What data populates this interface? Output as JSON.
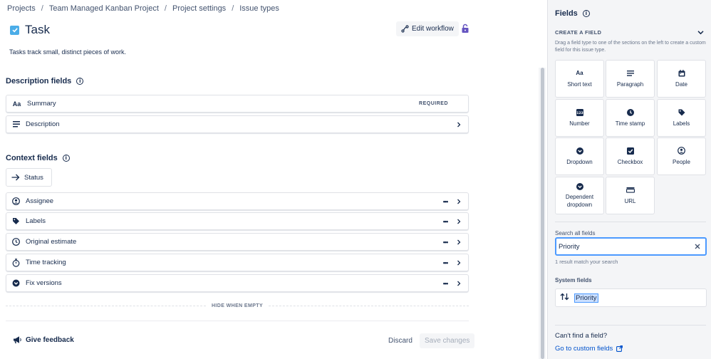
{
  "breadcrumb": [
    "Projects",
    "Team Managed Kanban Project",
    "Project settings",
    "Issue types"
  ],
  "issue": {
    "title": "Task",
    "description": "Tasks track small, distinct pieces of work.",
    "edit_workflow_label": "Edit workflow",
    "icon_color": "#4bade8"
  },
  "description_fields": {
    "heading": "Description fields",
    "items": [
      {
        "label": "Summary",
        "icon": "short-text-icon",
        "badge": "REQUIRED"
      },
      {
        "label": "Description",
        "icon": "paragraph-icon"
      }
    ]
  },
  "context_fields": {
    "heading": "Context fields",
    "status_label": "Status",
    "items": [
      {
        "label": "Assignee",
        "icon": "person-icon"
      },
      {
        "label": "Labels",
        "icon": "tag-icon"
      },
      {
        "label": "Original estimate",
        "icon": "clock-icon"
      },
      {
        "label": "Time tracking",
        "icon": "stopwatch-icon"
      },
      {
        "label": "Fix versions",
        "icon": "dropdown-circle-icon"
      }
    ],
    "hide_when_empty": "HIDE WHEN EMPTY"
  },
  "footer": {
    "feedback_label": "Give feedback",
    "discard_label": "Discard",
    "save_label": "Save changes"
  },
  "panel": {
    "title": "Fields",
    "create_heading": "CREATE A FIELD",
    "create_description": "Drag a field type to one of the sections on the left to create a custom field for this issue type.",
    "field_types": [
      {
        "label": "Short text",
        "icon": "short-text-icon"
      },
      {
        "label": "Paragraph",
        "icon": "paragraph-icon"
      },
      {
        "label": "Date",
        "icon": "calendar-icon"
      },
      {
        "label": "Number",
        "icon": "number-icon"
      },
      {
        "label": "Time stamp",
        "icon": "clock-icon"
      },
      {
        "label": "Labels",
        "icon": "tag-icon"
      },
      {
        "label": "Dropdown",
        "icon": "dropdown-circle-icon"
      },
      {
        "label": "Checkbox",
        "icon": "checkbox-icon"
      },
      {
        "label": "People",
        "icon": "person-icon"
      },
      {
        "label": "Dependent dropdown",
        "icon": "dropdown-circle-icon"
      },
      {
        "label": "URL",
        "icon": "url-icon"
      }
    ],
    "search": {
      "label": "Search all fields",
      "value": "Priority",
      "result_count": "1 result match your search"
    },
    "system_fields_heading": "System fields",
    "system_fields": [
      {
        "label": "Priority",
        "icon": "priority-icon"
      }
    ],
    "cant_find": "Can't find a field?",
    "custom_link": "Go to custom fields"
  },
  "colors": {
    "accent": "#0052cc",
    "focus_border": "#4c9aff",
    "panel_bg": "#f4f5f7"
  }
}
